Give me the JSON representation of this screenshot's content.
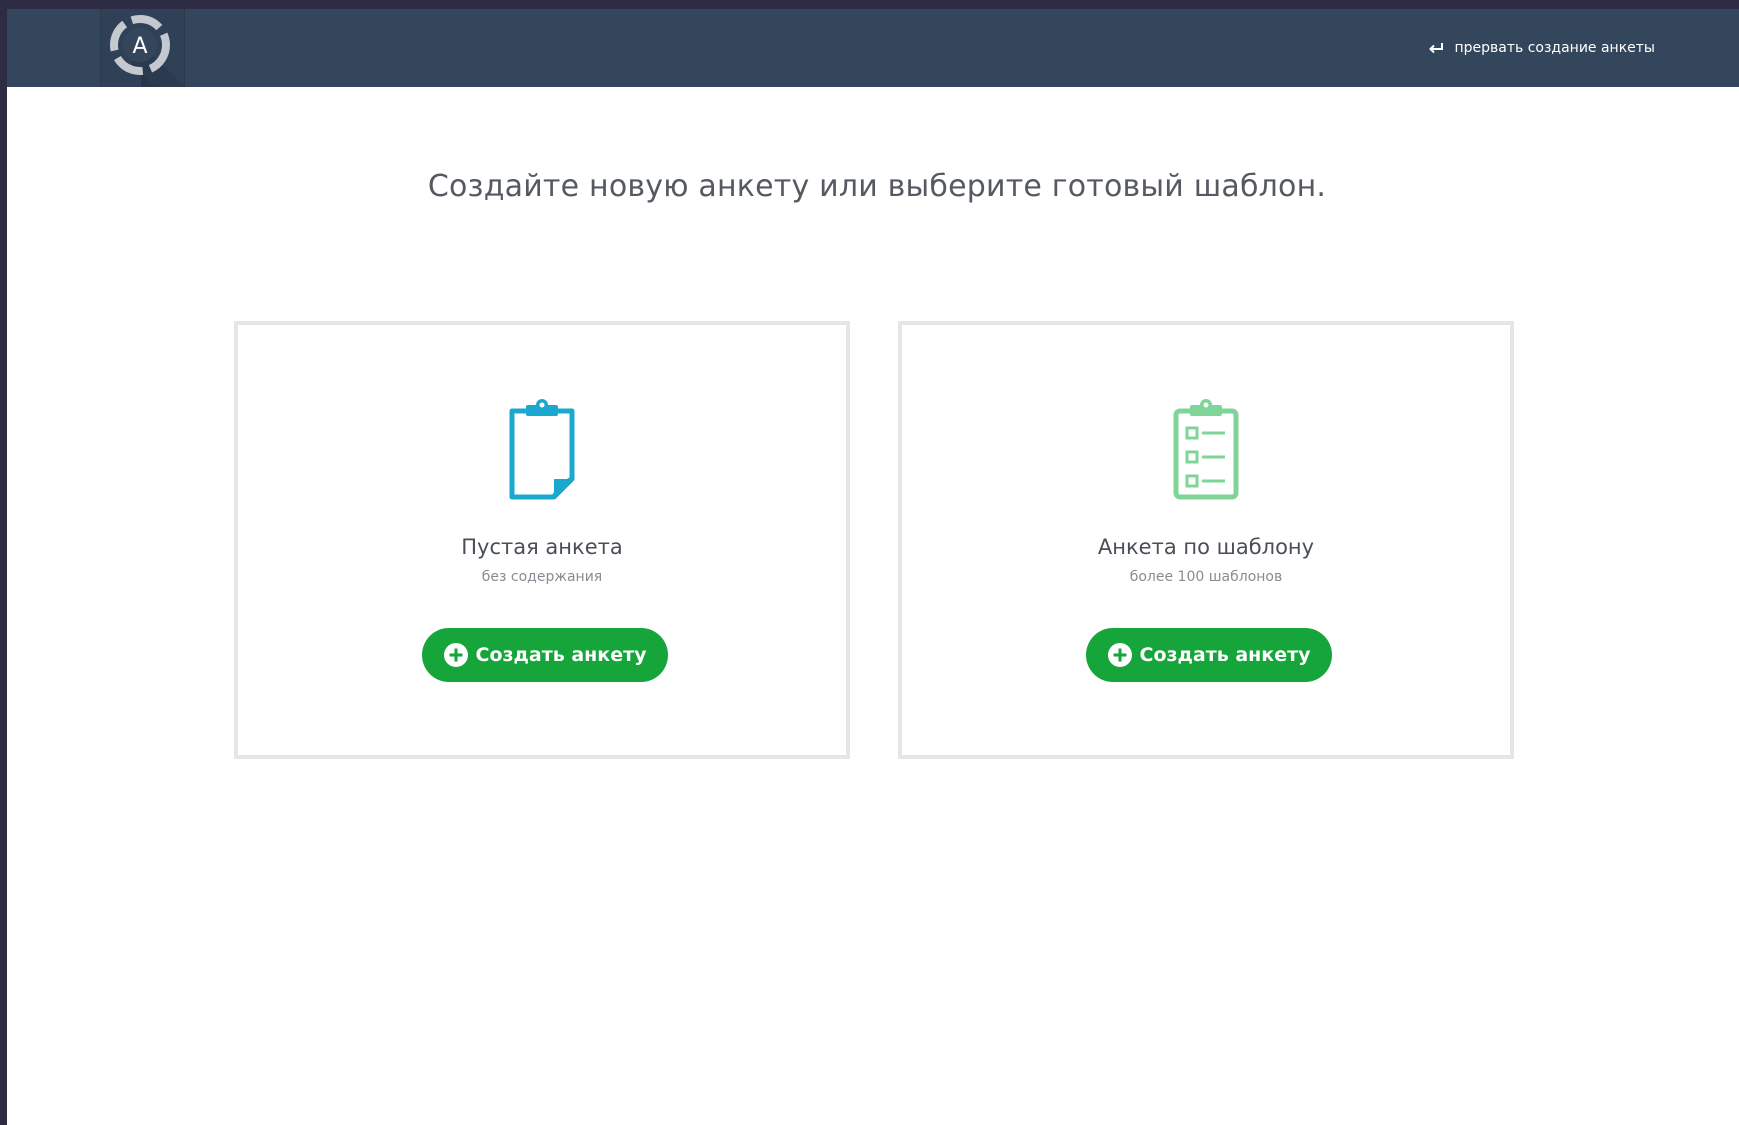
{
  "header": {
    "logo_letter": "A",
    "abort_label": "прервать создание анкеты"
  },
  "main": {
    "headline": "Создайте новую анкету или выберите готовый шаблон."
  },
  "cards": [
    {
      "title": "Пустая анкета",
      "subtitle": "без содержания",
      "button_label": "Создать анкету",
      "icon": "blank-clipboard-icon",
      "icon_color": "#1ba8cf"
    },
    {
      "title": "Анкета по шаблону",
      "subtitle": "более 100 шаблонов",
      "button_label": "Создать анкету",
      "icon": "checklist-clipboard-icon",
      "icon_color": "#7fd497"
    }
  ],
  "colors": {
    "header_bg": "#34465c",
    "button_bg": "#15a53b",
    "card_border": "#e6e6e6"
  }
}
